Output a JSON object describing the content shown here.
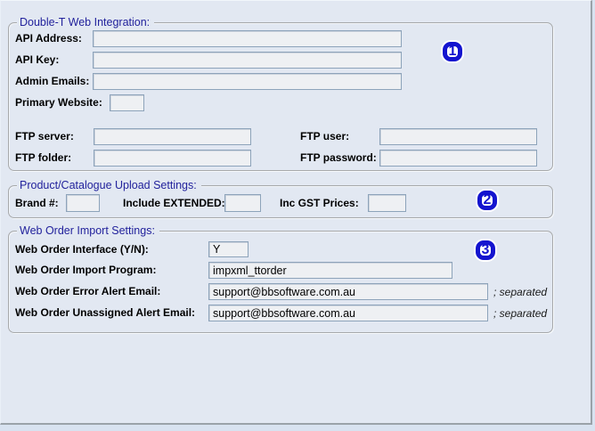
{
  "colors": {
    "panel_background": "#e2e8f2",
    "badge_blue": "#1414cf",
    "group_title_blue": "#22229c",
    "input_background": "#eef0f3",
    "frame_gray": "#9aa2a9"
  },
  "badges": {
    "one": "1",
    "two": "2",
    "three": "3"
  },
  "group1": {
    "title": "Double-T Web Integration:",
    "api_address_label": "API Address:",
    "api_address_value": "",
    "api_key_label": "API Key:",
    "api_key_value": "",
    "admin_emails_label": "Admin Emails:",
    "admin_emails_value": "",
    "primary_website_label": "Primary Website:",
    "primary_website_value": "",
    "ftp_server_label": "FTP server:",
    "ftp_server_value": "",
    "ftp_user_label": "FTP user:",
    "ftp_user_value": "",
    "ftp_folder_label": "FTP folder:",
    "ftp_folder_value": "",
    "ftp_password_label": "FTP password:",
    "ftp_password_value": ""
  },
  "group2": {
    "title": "Product/Catalogue Upload Settings:",
    "brand_label": "Brand #:",
    "brand_value": "",
    "include_extended_label": "Include EXTENDED:",
    "include_extended_value": "",
    "inc_gst_label": "Inc GST Prices:",
    "inc_gst_value": ""
  },
  "group3": {
    "title": "Web Order Import Settings:",
    "interface_label": "Web Order Interface (Y/N):",
    "interface_value": "Y",
    "program_label": "Web Order Import Program:",
    "program_value": "impxml_ttorder",
    "error_email_label": "Web Order Error Alert Email:",
    "error_email_value": "support@bbsoftware.com.au",
    "error_email_note": "; separated",
    "unassigned_email_label": "Web Order Unassigned Alert Email:",
    "unassigned_email_value": "support@bbsoftware.com.au",
    "unassigned_email_note": "; separated"
  }
}
